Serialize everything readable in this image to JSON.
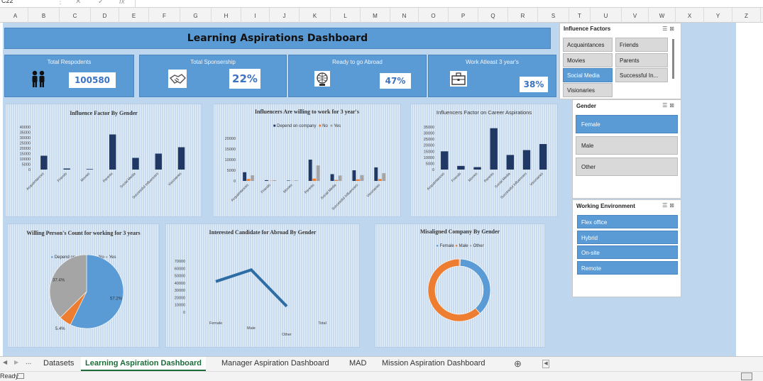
{
  "formula_bar": {
    "name_box": "C22",
    "fx": "fx"
  },
  "columns": [
    "A",
    "B",
    "C",
    "D",
    "E",
    "F",
    "G",
    "H",
    "I",
    "J",
    "K",
    "L",
    "M",
    "N",
    "O",
    "P",
    "Q",
    "R",
    "S",
    "T",
    "U",
    "V",
    "W",
    "X",
    "Y",
    "Z"
  ],
  "title": "Learning Aspirations Dashboard",
  "kpis": [
    {
      "label": "Total Respodents",
      "value": "100580",
      "icon": "people-icon"
    },
    {
      "label": "Total Sponsership",
      "value": "22%",
      "icon": "handshake-icon"
    },
    {
      "label": "Ready to go Abroad",
      "value": "47%",
      "icon": "globe-person-icon"
    },
    {
      "label": "Work Atleast 3 year's",
      "value": "38%",
      "icon": "briefcase-icon"
    }
  ],
  "charts": {
    "c1": {
      "title": "Influence Factor By Gender",
      "chart_data": {
        "type": "bar",
        "categories": [
          "Acquaintances",
          "Friends",
          "Movies",
          "Parents",
          "Social Media",
          "Successful Influencers",
          "Visionaries"
        ],
        "y_ticks": [
          "40000",
          "35000",
          "30000",
          "25000",
          "20000",
          "15000",
          "10000",
          "5000",
          "0"
        ],
        "ylim": [
          0,
          40000
        ],
        "values": [
          13000,
          1000,
          500,
          33000,
          11000,
          15000,
          21000
        ]
      }
    },
    "c2": {
      "title": "Influencers Are willing to work for 3 year's",
      "chart_data": {
        "type": "bar",
        "categories": [
          "Acquaintances",
          "Friends",
          "Movies",
          "Parents",
          "Social Media",
          "Successful Influencers",
          "Visionaries"
        ],
        "y_ticks": [
          "20000",
          "15000",
          "10000",
          "5000",
          "0"
        ],
        "ylim": [
          0,
          22000
        ],
        "series": [
          {
            "name": "Depend on company",
            "values": [
              4500,
              400,
              200,
              11000,
              3500,
              5500,
              7000
            ],
            "color": "#1f3864"
          },
          {
            "name": "No",
            "values": [
              1000,
              100,
              80,
              1200,
              500,
              800,
              1000
            ],
            "color": "#ed7d31"
          },
          {
            "name": "Yes",
            "values": [
              2900,
              400,
              300,
              8000,
              2800,
              3000,
              4000
            ],
            "color": "#a5a5a5"
          }
        ]
      }
    },
    "c3": {
      "title": "Influencers Factor on Career Aspirations",
      "chart_data": {
        "type": "bar",
        "categories": [
          "Acquaintances",
          "Friends",
          "Movies",
          "Parents",
          "Social Media",
          "Successful Influencers",
          "Visionaries"
        ],
        "y_ticks": [
          "35000",
          "30000",
          "25000",
          "20000",
          "15000",
          "10000",
          "5000",
          "0"
        ],
        "ylim": [
          0,
          35000
        ],
        "values": [
          15000,
          3000,
          2000,
          34000,
          12000,
          16000,
          21000
        ]
      }
    },
    "c4": {
      "title": "Willing Person's Count for working for 3 years",
      "chart_data": {
        "type": "pie",
        "labels": [
          "Depend on company",
          "No",
          "Yes"
        ],
        "values": [
          57.2,
          5.4,
          37.4
        ],
        "value_labels": [
          "57.2%",
          "5.4%",
          "37.4%"
        ],
        "colors": [
          "#5b9bd5",
          "#ed7d31",
          "#a5a5a5"
        ]
      }
    },
    "c5": {
      "title": "Interested Candidate for Abroad By Gender",
      "chart_data": {
        "type": "line",
        "categories": [
          "Female",
          "Male",
          "Other",
          "Total"
        ],
        "y_ticks": [
          "70000",
          "60000",
          "50000",
          "40000",
          "30000",
          "20000",
          "10000",
          "0"
        ],
        "ylim": [
          0,
          70000
        ],
        "values": [
          42000,
          58000,
          8000,
          null
        ]
      }
    },
    "c6": {
      "title": "Misaligned Company By Gender",
      "chart_data": {
        "type": "pie",
        "labels": [
          "Female",
          "Male",
          "Other"
        ],
        "values": [
          38,
          62,
          0.5
        ],
        "colors": [
          "#5b9bd5",
          "#ed7d31",
          "#a5a5a5"
        ]
      }
    }
  },
  "slicers": {
    "influence": {
      "title": "Influence Factors",
      "items": [
        "Acquaintances",
        "Friends",
        "Movies",
        "Parents",
        "Social Media",
        "Successful In...",
        "Visionaries"
      ],
      "selected": [
        "Social Media"
      ]
    },
    "gender": {
      "title": "Gender",
      "items": [
        "Female",
        "Male",
        "Other"
      ],
      "selected": [
        "Female"
      ]
    },
    "work_env": {
      "title": "Working Environment",
      "items": [
        "Flex office",
        "Hybrid",
        "On-site",
        "Remote"
      ],
      "selected": [
        "Flex office",
        "Hybrid",
        "On-site",
        "Remote"
      ]
    }
  },
  "tabs": [
    "Datasets",
    "Learning Aspiration Dashboard",
    "Manager Aspiration Dashboard",
    "MAD",
    "Mission Aspiration Dashboard"
  ],
  "active_tab": "Learning Aspiration Dashboard",
  "status": "Ready",
  "tab_nav": {
    "prev": "◀",
    "next": "▶",
    "more": "...",
    "add": "⊕"
  }
}
